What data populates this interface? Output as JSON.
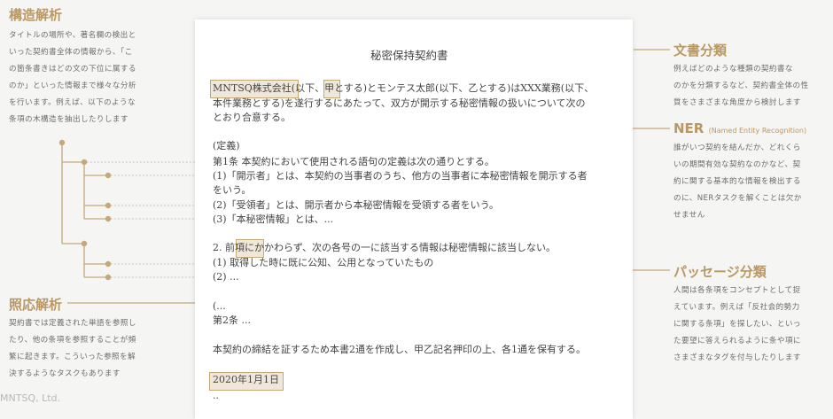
{
  "left": {
    "structure": {
      "title": "構造解析",
      "lines": [
        "タイトルの場所や、著名欄の検出と",
        "いった契約書全体の情報から、「こ",
        "の箇条書きはどの文の下位に属する",
        "のか」といった情報まで様々な分析",
        "を行います。例えば、以下のような",
        "条項の木構造を抽出したりします"
      ]
    },
    "coreference": {
      "title": "照応解析",
      "lines": [
        "契約書では定義された単語を参照し",
        "たり、他の条項を参照することが頻",
        "繁に起きます。こういった参照を解",
        "決するようなタスクもあります"
      ]
    },
    "footer": "MNTSQ, Ltd."
  },
  "right": {
    "doc_class": {
      "title": "文書分類",
      "lines": [
        "例えばどのような種類の契約書な",
        "のかを分類するなど、契約書全体の性",
        "質をさまざまな角度から検討します"
      ]
    },
    "ner": {
      "title": "NER",
      "subtitle": "(Named Entity Recognition)",
      "lines": [
        "誰がいつ契約を結んだか、どれくら",
        "いの期間有効な契約なのかなど、契",
        "約に関する基本的な情報を検出する",
        "のに、NERタスクを解くことは欠か",
        "せません"
      ]
    },
    "passage": {
      "title": "パッセージ分類",
      "lines": [
        "人間は各条項をコンセプトとして捉",
        "えています。例えば「反社会的勢力",
        "に関する条項」を探したい、といっ",
        "た要望に答えられるように条や項に",
        "さまざまなタグを付与したりします"
      ]
    }
  },
  "document": {
    "title": "秘密保持契約書",
    "lines": [
      "MNTSQ株式会社(以下、甲とする)とモンテス太郎(以下、乙とする)はXXX業務(以下、",
      "本件業務とする)を遂行するにあたって、双方が開示する秘密情報の扱いについて次の",
      "とおり合意する。",
      "(定義)",
      "第1条 本契約において使用される語句の定義は次の通りとする。",
      "(1)「開示者」とは、本契約の当事者のうち、他方の当事者に本秘密情報を開示する者",
      "をいう。",
      "(2)「受領者」とは、開示者から本秘密情報を受領する者をいう。",
      "(3)「本秘密情報」とは、...",
      "2. 前項にかかわらず、次の各号の一に該当する情報は秘密情報に該当しない。",
      "(1) 取得した時に既に公知、公用となっていたもの",
      "(2) ...",
      "(...",
      "第2条 ...",
      "本契約の締結を証するため本書2通を作成し、甲乙記名押印の上、各1通を保有する。",
      "2020年1月1日",
      ".."
    ]
  }
}
